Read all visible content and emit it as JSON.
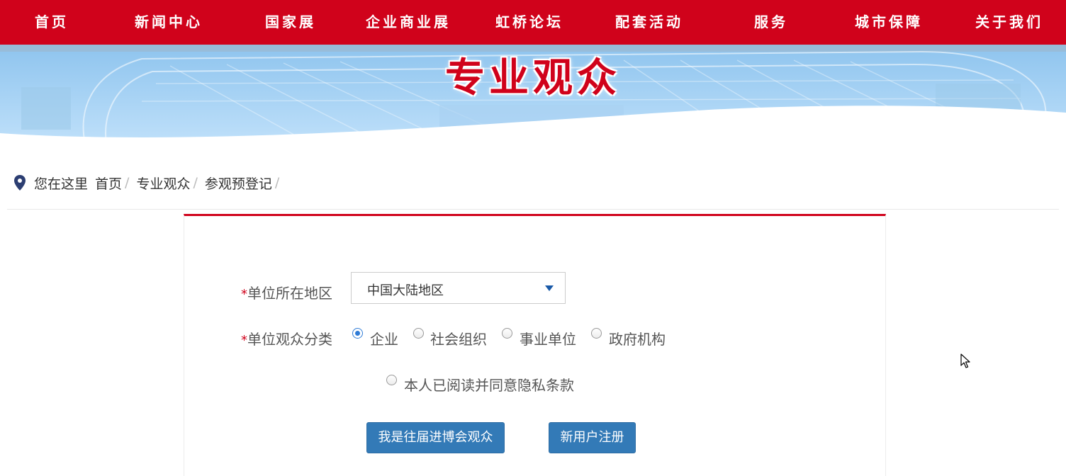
{
  "nav": {
    "items": [
      {
        "key": "home",
        "label": "首页"
      },
      {
        "key": "news",
        "label": "新闻中心"
      },
      {
        "key": "country",
        "label": "国家展"
      },
      {
        "key": "business",
        "label": "企业商业展"
      },
      {
        "key": "forum",
        "label": "虹桥论坛"
      },
      {
        "key": "events",
        "label": "配套活动"
      },
      {
        "key": "services",
        "label": "服务"
      },
      {
        "key": "city",
        "label": "城市保障"
      },
      {
        "key": "about",
        "label": "关于我们"
      }
    ]
  },
  "hero": {
    "title": "专业观众"
  },
  "breadcrumb": {
    "prefix": "您在这里",
    "items": [
      "首页",
      "专业观众",
      "参观预登记"
    ],
    "separator": "/"
  },
  "form": {
    "region": {
      "required_mark": "*",
      "label": "单位所在地区",
      "value": "中国大陆地区"
    },
    "category": {
      "required_mark": "*",
      "label": "单位观众分类",
      "options": [
        {
          "label": "企业",
          "checked": true
        },
        {
          "label": "社会组织",
          "checked": false
        },
        {
          "label": "事业单位",
          "checked": false
        },
        {
          "label": "政府机构",
          "checked": false
        }
      ]
    },
    "privacy": {
      "label": "本人已阅读并同意隐私条款",
      "checked": false
    },
    "buttons": {
      "returning": "我是往届进博会观众",
      "register": "新用户注册"
    }
  },
  "colors": {
    "brand_red": "#d0021b",
    "button_blue": "#337ab7",
    "radio_blue": "#2f7bd6"
  }
}
